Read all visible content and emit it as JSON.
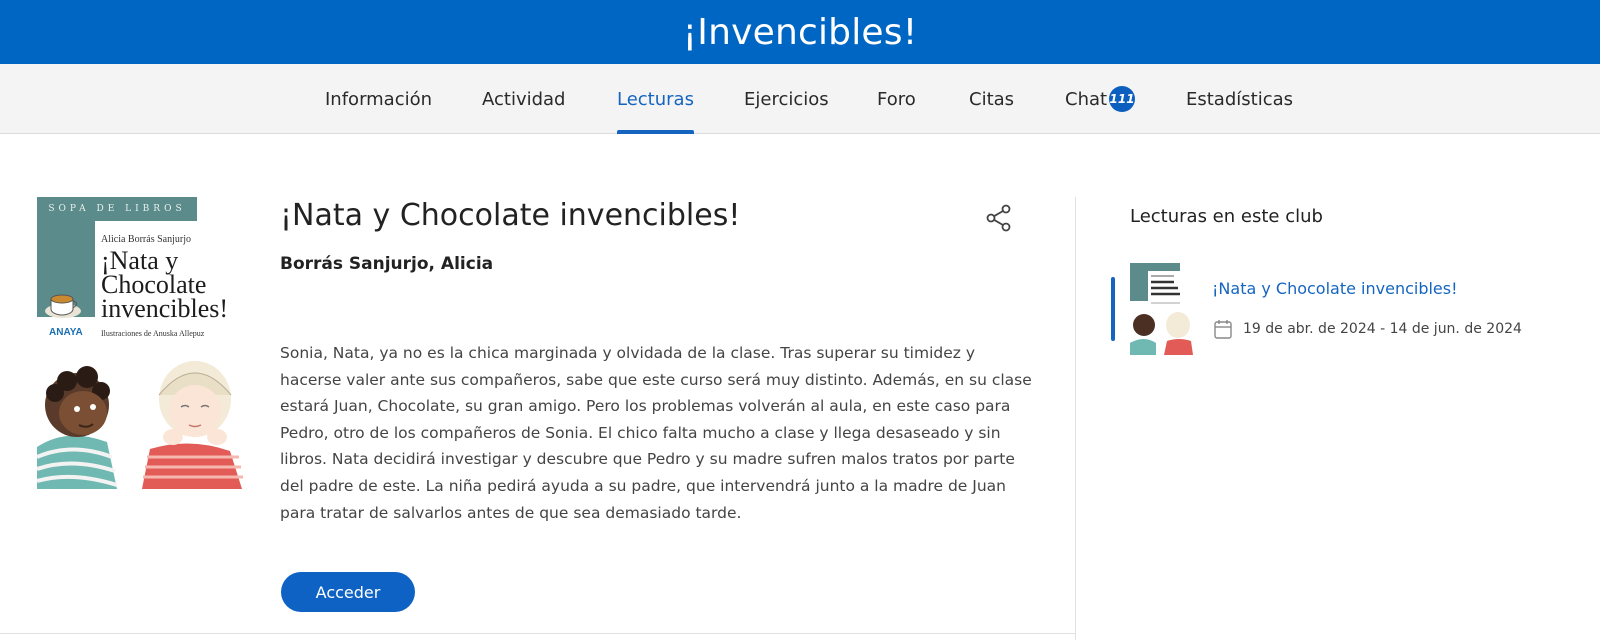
{
  "header": {
    "title": "¡Invencibles!"
  },
  "nav": {
    "items": [
      {
        "label": "Información"
      },
      {
        "label": "Actividad"
      },
      {
        "label": "Lecturas",
        "active": true
      },
      {
        "label": "Ejercicios"
      },
      {
        "label": "Foro"
      },
      {
        "label": "Citas"
      },
      {
        "label": "Chat",
        "badge": "111"
      },
      {
        "label": "Estadísticas"
      }
    ]
  },
  "cover": {
    "series": "SOPA DE LIBROS",
    "author": "Alicia Borrás Sanjurjo",
    "title_lines": [
      "¡Nata y",
      "Chocolate",
      "invencibles!"
    ],
    "publisher": "ANAYA",
    "illustrator": "Ilustraciones de Anuska Allepuz"
  },
  "book": {
    "title": "¡Nata y Chocolate invencibles!",
    "author": "Borrás Sanjurjo, Alicia",
    "description": "Sonia, Nata, ya no es la chica marginada y olvidada de la clase. Tras superar su timidez y hacerse valer ante sus compañeros, sabe que este curso será muy distinto. Además, en su clase estará Juan, Chocolate, su gran amigo. Pero los problemas volverán al aula, en este caso para Pedro, otro de los compañeros de Sonia. El chico falta mucho a clase y llega desaseado y sin libros. Nata decidirá investigar y descubre que Pedro y su madre sufren malos tratos por parte del padre de este. La niña pedirá ayuda a su padre, que intervendrá junto a la madre de Juan para tratar de salvarlos antes de que sea demasiado tarde.",
    "access_label": "Acceder"
  },
  "sidebar": {
    "heading": "Lecturas en este club",
    "readings": [
      {
        "title": "¡Nata y Chocolate invencibles!",
        "dates": "19 de abr. de 2024 - 14 de jun. de 2024"
      }
    ]
  },
  "colors": {
    "primary": "#0066c4",
    "accent": "#1565c0",
    "nav_bg": "#f4f4f4"
  }
}
